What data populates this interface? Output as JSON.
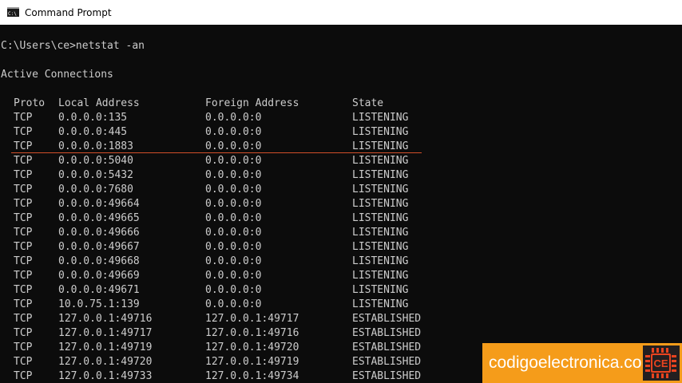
{
  "window": {
    "title": "Command Prompt",
    "icon": "cmd-icon"
  },
  "console": {
    "prompt_line": "C:\\Users\\ce>netstat -an",
    "heading": "Active Connections",
    "columns": [
      "Proto",
      "Local Address",
      "Foreign Address",
      "State"
    ],
    "rows": [
      [
        "TCP",
        "0.0.0.0:135",
        "0.0.0.0:0",
        "LISTENING"
      ],
      [
        "TCP",
        "0.0.0.0:445",
        "0.0.0.0:0",
        "LISTENING"
      ],
      [
        "TCP",
        "0.0.0.0:1883",
        "0.0.0.0:0",
        "LISTENING"
      ],
      [
        "TCP",
        "0.0.0.0:5040",
        "0.0.0.0:0",
        "LISTENING"
      ],
      [
        "TCP",
        "0.0.0.0:5432",
        "0.0.0.0:0",
        "LISTENING"
      ],
      [
        "TCP",
        "0.0.0.0:7680",
        "0.0.0.0:0",
        "LISTENING"
      ],
      [
        "TCP",
        "0.0.0.0:49664",
        "0.0.0.0:0",
        "LISTENING"
      ],
      [
        "TCP",
        "0.0.0.0:49665",
        "0.0.0.0:0",
        "LISTENING"
      ],
      [
        "TCP",
        "0.0.0.0:49666",
        "0.0.0.0:0",
        "LISTENING"
      ],
      [
        "TCP",
        "0.0.0.0:49667",
        "0.0.0.0:0",
        "LISTENING"
      ],
      [
        "TCP",
        "0.0.0.0:49668",
        "0.0.0.0:0",
        "LISTENING"
      ],
      [
        "TCP",
        "0.0.0.0:49669",
        "0.0.0.0:0",
        "LISTENING"
      ],
      [
        "TCP",
        "0.0.0.0:49671",
        "0.0.0.0:0",
        "LISTENING"
      ],
      [
        "TCP",
        "10.0.75.1:139",
        "0.0.0.0:0",
        "LISTENING"
      ],
      [
        "TCP",
        "127.0.0.1:49716",
        "127.0.0.1:49717",
        "ESTABLISHED"
      ],
      [
        "TCP",
        "127.0.0.1:49717",
        "127.0.0.1:49716",
        "ESTABLISHED"
      ],
      [
        "TCP",
        "127.0.0.1:49719",
        "127.0.0.1:49720",
        "ESTABLISHED"
      ],
      [
        "TCP",
        "127.0.0.1:49720",
        "127.0.0.1:49719",
        "ESTABLISHED"
      ],
      [
        "TCP",
        "127.0.0.1:49733",
        "127.0.0.1:49734",
        "ESTABLISHED"
      ]
    ],
    "highlighted_row_index": 2
  },
  "watermark": {
    "text": "codigoelectronica.com",
    "logo_text": "CE",
    "logo_icon": "chip-icon"
  },
  "colors": {
    "console_bg": "#0c0c0c",
    "console_text": "#cccccc",
    "highlight": "#d24f2a",
    "watermark_bg": "#f59c1a",
    "logo_bg": "#231f20",
    "logo_accent": "#e8431f"
  }
}
